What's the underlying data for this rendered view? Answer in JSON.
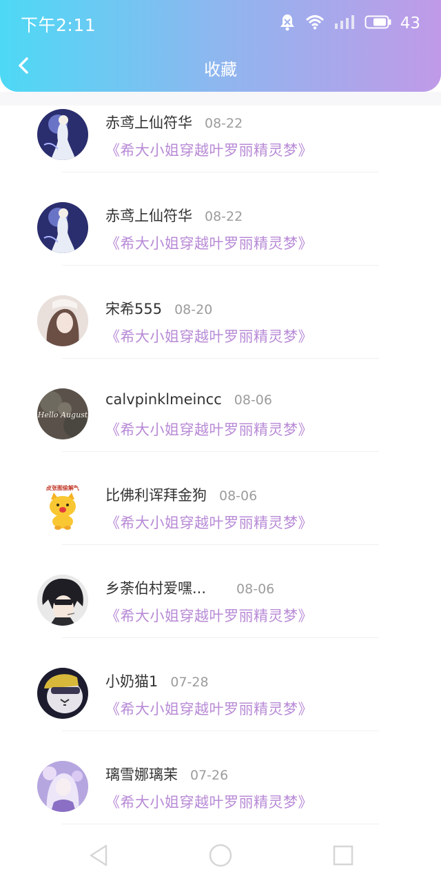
{
  "status": {
    "time": "下午2:11",
    "battery": "43"
  },
  "header": {
    "title": "收藏"
  },
  "items": [
    {
      "name": "赤鸢上仙符华",
      "date": "08-22",
      "book": "《希大小姐穿越叶罗丽精灵梦》"
    },
    {
      "name": "赤鸢上仙符华",
      "date": "08-22",
      "book": "《希大小姐穿越叶罗丽精灵梦》"
    },
    {
      "name": "宋希555",
      "date": "08-20",
      "book": "《希大小姐穿越叶罗丽精灵梦》"
    },
    {
      "name": "calvpinklmeincc",
      "date": "08-06",
      "book": "《希大小姐穿越叶罗丽精灵梦》"
    },
    {
      "name": "比佛利诨拜金狗",
      "date": "08-06",
      "book": "《希大小姐穿越叶罗丽精灵梦》"
    },
    {
      "name": "乡荼伯村爱嘿...",
      "date": "08-06",
      "book": "《希大小姐穿越叶罗丽精灵梦》"
    },
    {
      "name": "小奶猫1",
      "date": "07-28",
      "book": "《希大小姐穿越叶罗丽精灵梦》"
    },
    {
      "name": "璃雪娜璃茉",
      "date": "07-26",
      "book": "《希大小姐穿越叶罗丽精灵梦》"
    }
  ],
  "avatar_badge": "皮张图偷解气",
  "avatar_script": "Hello August",
  "colors": {
    "accent_start": "#4dd9f5",
    "accent_end": "#c09ae8",
    "book_title": "#b88ad6"
  },
  "icons": {
    "back": "chevron-left-icon",
    "nav_back": "triangle-back-icon",
    "nav_home": "circle-home-icon",
    "nav_recent": "square-recent-icon"
  }
}
